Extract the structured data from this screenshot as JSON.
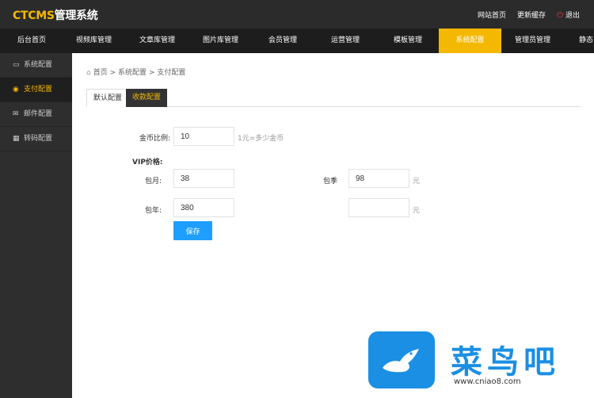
{
  "header": {
    "logo_brand": "CTCMS",
    "logo_suffix": "管理系统",
    "links": [
      "网站首页",
      "更新缓存",
      "退出"
    ]
  },
  "nav": {
    "items": [
      "后台首页",
      "视频库管理",
      "文章库管理",
      "图片库管理",
      "会员管理",
      "运营管理",
      "模板管理",
      "系统配置",
      "管理员管理",
      "静态"
    ],
    "active": "系统配置"
  },
  "sidebar": {
    "items": [
      {
        "label": "系统配置",
        "icon": "monitor-icon"
      },
      {
        "label": "支付配置",
        "icon": "coin-icon"
      },
      {
        "label": "邮件配置",
        "icon": "mail-icon"
      },
      {
        "label": "转码配置",
        "icon": "grid-icon"
      }
    ],
    "active": "支付配置"
  },
  "breadcrumb": {
    "home": "首页",
    "sep": ">",
    "level1": "系统配置",
    "level2": "支付配置"
  },
  "tabs": {
    "default_label": "默认配置",
    "active_label": "收款配置"
  },
  "form": {
    "coin_ratio_label": "金币比例:",
    "coin_ratio_value": "10",
    "coin_ratio_hint": "1元=多少金币",
    "vip_title": "VIP价格:",
    "monthly_label": "包月:",
    "monthly_value": "38",
    "quarter_label": "包季",
    "quarter_value": "98",
    "yearly_label": "包年:",
    "yearly_value": "380",
    "unit": "元",
    "save_label": "保存"
  },
  "watermark": {
    "text": "菜鸟吧",
    "url": "www.cniao8.com"
  },
  "colors": {
    "accent": "#f5b800",
    "primary_button": "#1e9fff",
    "topbar": "#2b2b2b",
    "navbar": "#1d1d1d",
    "sidebar": "#2e2e2e"
  }
}
